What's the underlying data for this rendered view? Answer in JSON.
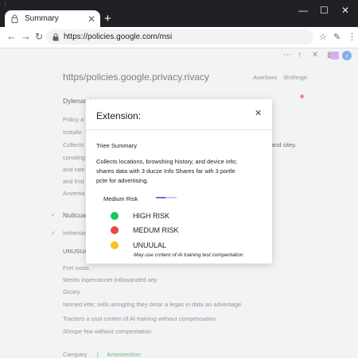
{
  "browser": {
    "tab_title": "Summary",
    "new_tab": "+",
    "controls": {
      "minimize": "—",
      "maximize": "☐",
      "close": "✕"
    },
    "url": "https://policies.google.com/msi"
  },
  "page": {
    "heading": "https/policies.google.privacy.rivacy",
    "header_right_1": "Averlows",
    "header_right_2": "!Enfnnge",
    "section_title": "Dylenarchy",
    "lines": [
      "Policy a",
      "Installe",
      "Collects",
      "consting",
      "and rate",
      "and frist",
      "Anvertia"
    ],
    "collects_suffix": "and sitey.",
    "list_items": [
      {
        "mark": "✓",
        "label": "Nuticua"
      },
      {
        "mark": "✓",
        "label": "Imhentar"
      }
    ],
    "unusual_label": "UNUSUAL",
    "bottom_lines": [
      "Fret nosis",
      "Werits inpercannet intlowanded oity",
      "Gizary",
      "Nomed ette; sells annigting they detar a legas in data an advertiage",
      "Tracters a usst conten of AI training without compensation",
      "Shrope few without compentation"
    ],
    "footer_left": "Campary",
    "footer_right": "Amossection",
    "colors": {
      "footer_link": "#1a9c3c"
    }
  },
  "modal": {
    "title": "Extension:",
    "close": "✕",
    "subtitle": "Triee Summary",
    "description": [
      "Collects locations, browshing history, and device info;",
      "shares data with 3 ducze Info Shares far wih 3 portle",
      "pcte for advertising."
    ],
    "risk_label": "Medium Risk",
    "risk_level": 0.45,
    "legend": [
      {
        "label": "HIGH RISK",
        "color": "#1fc65a"
      },
      {
        "label": "MEDUM RISK",
        "color": "#ea4a3e"
      },
      {
        "label": "UNUULAL",
        "color": "#f5c518"
      }
    ],
    "footnote": "·May use crntent of AI training test compentation"
  }
}
